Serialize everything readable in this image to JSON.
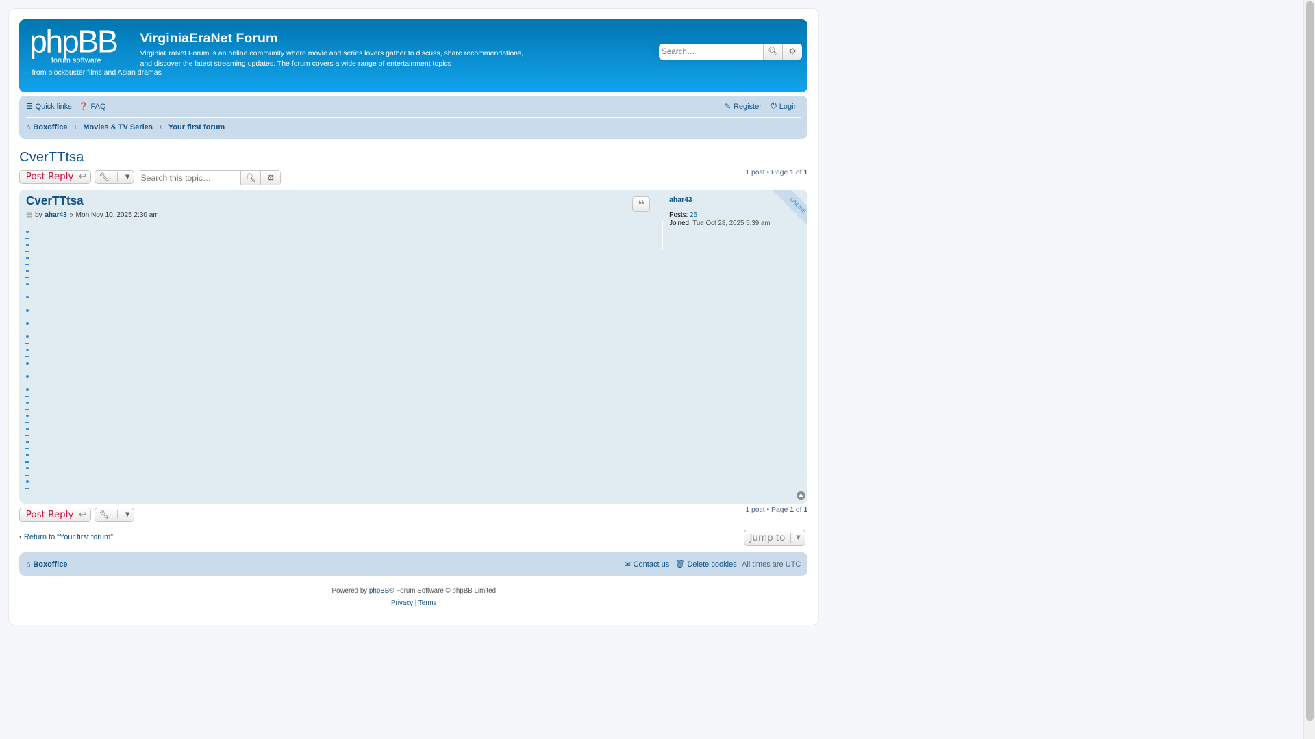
{
  "header": {
    "site_title": "VirginiaEraNet Forum",
    "site_desc_1": "VirginiaEraNet Forum is an online community where movie and series lovers gather to discuss, share recommendations, and discover the latest streaming updates. The forum covers a wide range of entertainment topics",
    "site_desc_2": "— from blockbuster films and Asian dramas",
    "logo_text": "phpBB forum software",
    "search_placeholder": "Search…"
  },
  "navbar": {
    "quick_links": "Quick links",
    "faq": "FAQ",
    "register": "Register",
    "login": "Login",
    "breadcrumbs": [
      "Boxoffice",
      "Movies & TV Series",
      "Your first forum"
    ]
  },
  "topic": {
    "title": "CverTTtsa",
    "post_reply": "Post Reply",
    "search_placeholder": "Search this topic…",
    "pagination": {
      "prefix": "1 post • Page",
      "page": "1",
      "of": "of",
      "total": "1"
    }
  },
  "post": {
    "title": "CverTTtsa",
    "by": "by",
    "author": "ahar43",
    "sep": "»",
    "date": "Mon Nov 10, 2025 2:30 am",
    "list_item_count": 20,
    "profile": {
      "username": "ahar43",
      "posts_label": "Posts:",
      "posts": "26",
      "joined_label": "Joined:",
      "joined": "Tue Oct 28, 2025 5:39 am",
      "status": "ONLINE"
    }
  },
  "bottom": {
    "return_link": "Return to “Your first forum”",
    "jump_to": "Jump to"
  },
  "footer": {
    "home": "Boxoffice",
    "contact": "Contact us",
    "delete_cookies": "Delete cookies",
    "timezone": "All times are UTC",
    "powered_prefix": "Powered by",
    "phpbb": "phpBB",
    "powered_suffix": "® Forum Software © phpBB Limited",
    "privacy": "Privacy",
    "sep": "|",
    "terms": "Terms"
  }
}
